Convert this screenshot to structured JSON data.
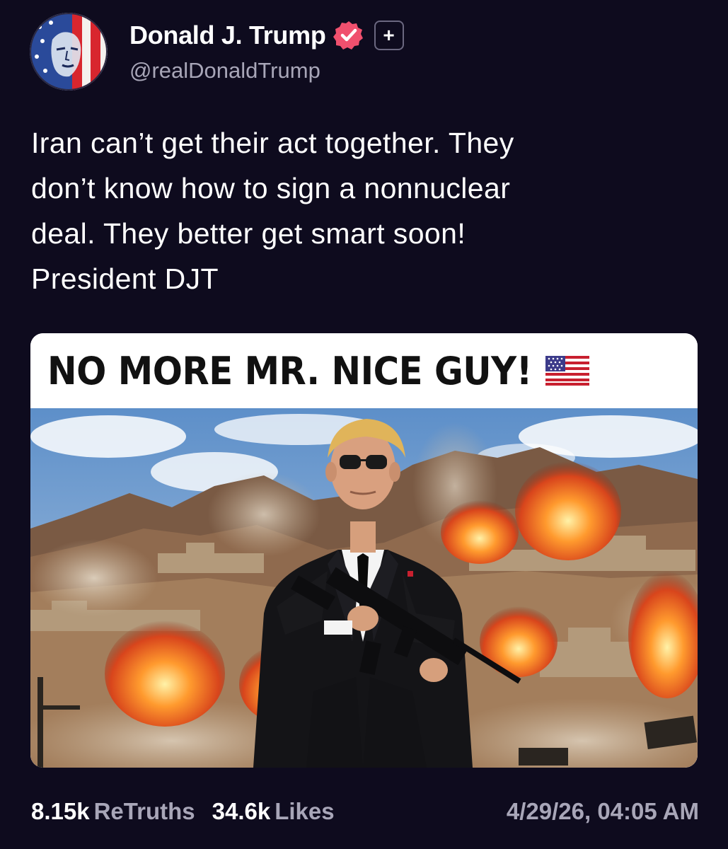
{
  "profile": {
    "display_name": "Donald J. Trump",
    "handle": "@realDonaldTrump",
    "avatar_icon": "user-avatar-flag-portrait",
    "verified_icon": "verified-badge-icon",
    "plus_badge_icon": "plus-badge-icon",
    "plus_badge_label": "+"
  },
  "post": {
    "text_lines": [
      "Iran can’t get their act together. They",
      "don’t know how to sign a nonnuclear",
      "deal. They better get smart soon!",
      "President DJT"
    ]
  },
  "media": {
    "banner_text": "NO MORE MR. NICE GUY!",
    "banner_emoji_icon": "us-flag-emoji-icon"
  },
  "footer": {
    "retruths_count": "8.15k",
    "retruths_label": "ReTruths",
    "likes_count": "34.6k",
    "likes_label": "Likes",
    "timestamp": "4/29/26, 04:05 AM"
  },
  "colors": {
    "background": "#0e0b1e",
    "text_primary": "#ffffff",
    "text_secondary": "#a8a6b8",
    "verified_badge": "#f0506e"
  }
}
